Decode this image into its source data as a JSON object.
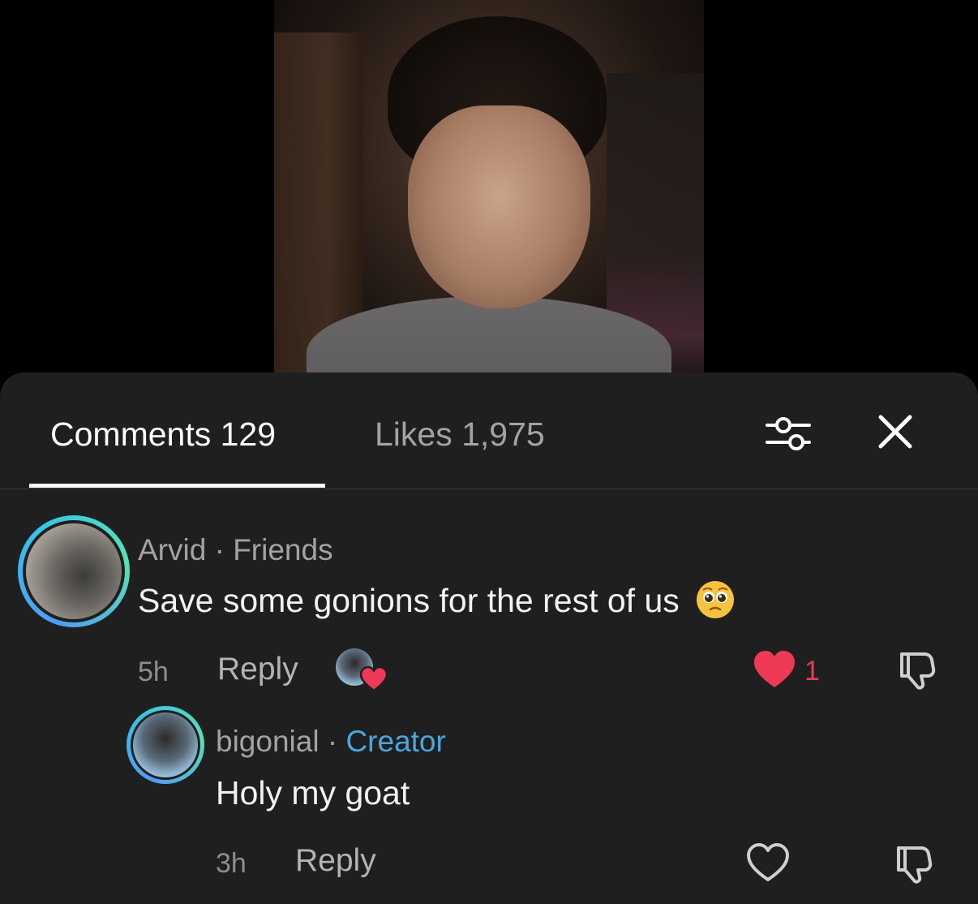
{
  "tabs": {
    "comments_label": "Comments 129",
    "likes_label": "Likes 1,975"
  },
  "comments": [
    {
      "author": "Arvid",
      "separator": "·",
      "tag": "Friends",
      "text": "Save some gonions for the rest of us",
      "emoji": "pleading-face",
      "time": "5h",
      "reply_label": "Reply",
      "like_count": "1",
      "liked": true,
      "liked_by_creator": true
    },
    {
      "author": "bigonial",
      "separator": "·",
      "tag": "Creator",
      "text": "Holy my goat",
      "time": "3h",
      "reply_label": "Reply",
      "liked": false
    }
  ],
  "colors": {
    "sheet_background": "#1f1f1f",
    "like_red": "#ee3a56",
    "creator_blue": "#4aa6e0",
    "avatar_ring": [
      "#4e9cf7",
      "#36c4e8",
      "#58e0b6"
    ]
  },
  "icons": {
    "filter": "sliders-icon",
    "close": "close-icon",
    "like": "heart-icon",
    "dislike": "thumbs-down-icon"
  }
}
